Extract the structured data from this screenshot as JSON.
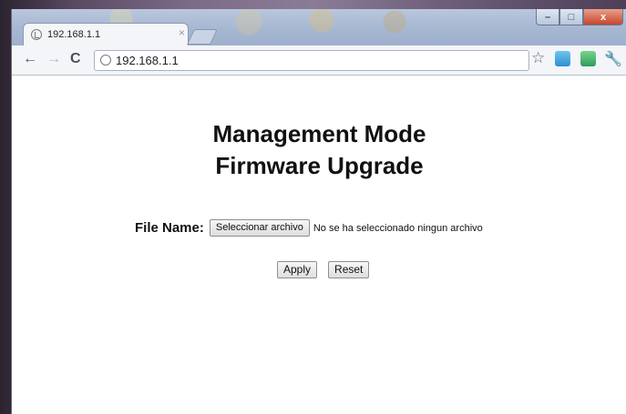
{
  "browser": {
    "tab_title": "192.168.1.1",
    "tab_close": "×",
    "url": "192.168.1.1",
    "window_controls": {
      "minimize": "–",
      "maximize": "□",
      "close": "x"
    }
  },
  "toolbar": {
    "back": "←",
    "forward": "→",
    "reload": "C",
    "star": "☆",
    "wrench": "🔧"
  },
  "page": {
    "heading_line1": "Management Mode",
    "heading_line2": "Firmware Upgrade",
    "file_label": "File Name:",
    "choose_button": "Seleccionar archivo",
    "no_file_text": "No se ha seleccionado ningun archivo",
    "apply_button": "Apply",
    "reset_button": "Reset"
  }
}
